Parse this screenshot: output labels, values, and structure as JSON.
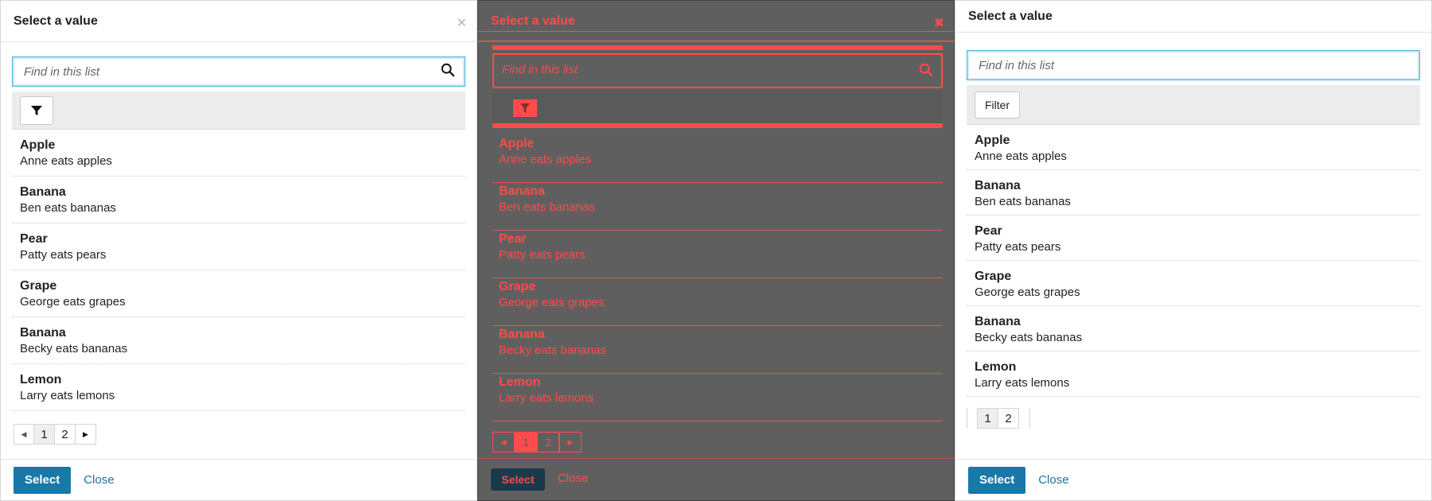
{
  "dialog": {
    "title": "Select a value",
    "search_placeholder": "Find in this list",
    "filter_label": "Filter",
    "select_label": "Select",
    "close_label": "Close"
  },
  "items": [
    {
      "name": "Apple",
      "desc": "Anne eats apples"
    },
    {
      "name": "Banana",
      "desc": "Ben eats bananas"
    },
    {
      "name": "Pear",
      "desc": "Patty eats pears"
    },
    {
      "name": "Grape",
      "desc": "George eats grapes"
    },
    {
      "name": "Banana",
      "desc": "Becky eats bananas"
    },
    {
      "name": "Lemon",
      "desc": "Larry eats lemons"
    }
  ],
  "pager": {
    "prev_icon": "triangle-left-icon",
    "next_icon": "triangle-right-icon",
    "pages": [
      "1",
      "2"
    ],
    "current": "1"
  },
  "colors": {
    "accent": "#1679a8",
    "overlay_bg": "#5f5f5f",
    "overlay_red": "#ff4b4b",
    "focus_border": "#47b4d8"
  },
  "icons": {
    "close": "close-icon",
    "search": "search-icon",
    "filter": "filter-funnel-icon"
  }
}
